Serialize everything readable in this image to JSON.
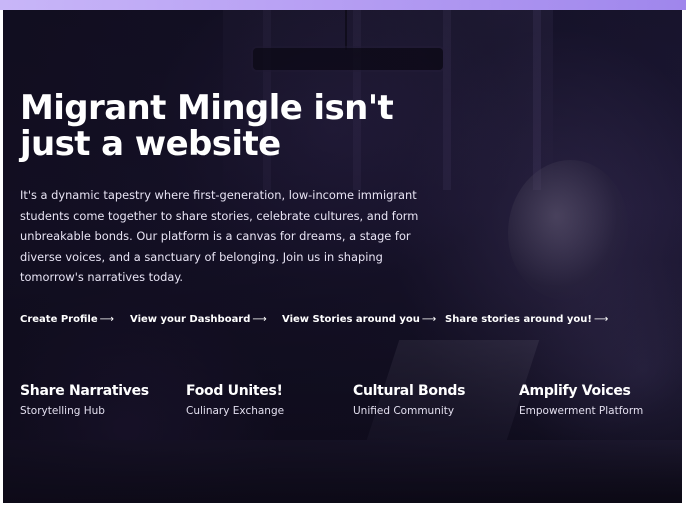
{
  "hero": {
    "headline": "Migrant Mingle isn't just a website",
    "description": "It's a dynamic tapestry where first-generation, low-income immigrant students come together to share stories, celebrate cultures, and form unbreakable bonds. Our platform is a canvas for dreams, a stage for diverse voices, and a sanctuary of belonging. Join us in shaping tomorrow's narratives today."
  },
  "ctas": [
    {
      "label": "Create Profile",
      "arrow": "⟶"
    },
    {
      "label": "View your Dashboard",
      "arrow": "⟶"
    },
    {
      "label": "View Stories around you",
      "arrow": "⟶"
    },
    {
      "label": "Share stories around you!",
      "arrow": "⟶"
    }
  ],
  "features": [
    {
      "title": "Share Narratives",
      "subtitle": "Storytelling Hub"
    },
    {
      "title": "Food Unites!",
      "subtitle": "Culinary Exchange"
    },
    {
      "title": "Cultural Bonds",
      "subtitle": "Unified Community"
    },
    {
      "title": "Amplify Voices",
      "subtitle": "Empowerment Platform"
    }
  ],
  "colors": {
    "top_accent": "#b9a2f4",
    "hero_overlay": "#120f22",
    "text_primary": "#ffffff"
  }
}
